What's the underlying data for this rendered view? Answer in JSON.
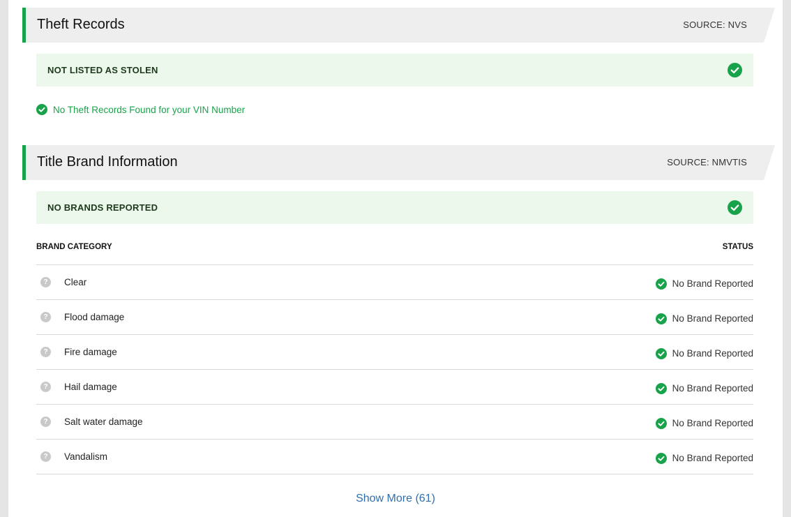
{
  "theft": {
    "title": "Theft Records",
    "source": "SOURCE: NVS",
    "status_label": "NOT LISTED AS STOLEN",
    "note": "No Theft Records Found for your VIN Number"
  },
  "title_brand": {
    "title": "Title Brand Information",
    "source": "SOURCE: NMVTIS",
    "status_label": "NO BRANDS REPORTED",
    "table": {
      "columns": [
        "BRAND CATEGORY",
        "STATUS"
      ],
      "rows": [
        {
          "category": "Clear",
          "status": "No Brand Reported"
        },
        {
          "category": "Flood damage",
          "status": "No Brand Reported"
        },
        {
          "category": "Fire damage",
          "status": "No Brand Reported"
        },
        {
          "category": "Hail damage",
          "status": "No Brand Reported"
        },
        {
          "category": "Salt water damage",
          "status": "No Brand Reported"
        },
        {
          "category": "Vandalism",
          "status": "No Brand Reported"
        }
      ]
    },
    "show_more": "Show More (61)"
  },
  "icons": {
    "check": "check-circle-icon",
    "help": "help-circle-icon",
    "help_glyph": "?"
  },
  "colors": {
    "accent_green": "#18a34a",
    "status_bg": "#edf8ec",
    "header_bg": "#eeeeee",
    "link_blue": "#2f6fae",
    "help_gray": "#c9c9c9"
  }
}
